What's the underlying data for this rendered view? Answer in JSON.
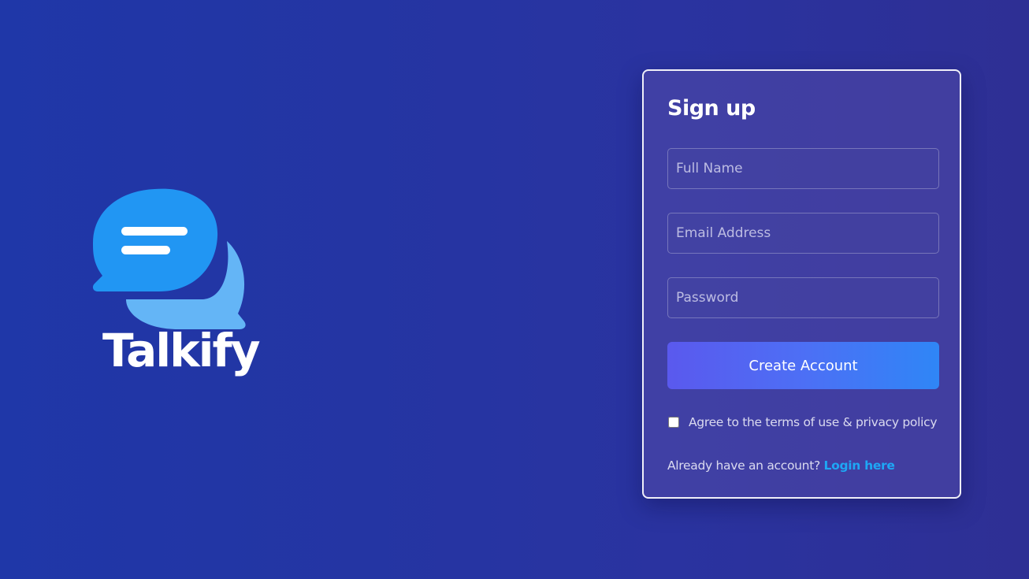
{
  "brand": {
    "name": "Talkify",
    "logo_icon": "chat-bubbles-icon",
    "colors": {
      "bubble_front": "#2196f3",
      "bubble_back": "#64b5f6",
      "lines": "#ffffff"
    }
  },
  "signup": {
    "title": "Sign up",
    "full_name_placeholder": "Full Name",
    "email_placeholder": "Email Address",
    "password_placeholder": "Password",
    "submit_label": "Create Account",
    "agree_label": "Agree to the terms of use & privacy policy",
    "agree_checked": false,
    "login_prompt": "Already have an account?",
    "login_link": "Login here"
  },
  "colors": {
    "background_start": "#1f37a8",
    "background_end": "#2e2f94",
    "button_start": "#5a59ee",
    "button_end": "#2f86f6",
    "link": "#1ea7f5"
  }
}
